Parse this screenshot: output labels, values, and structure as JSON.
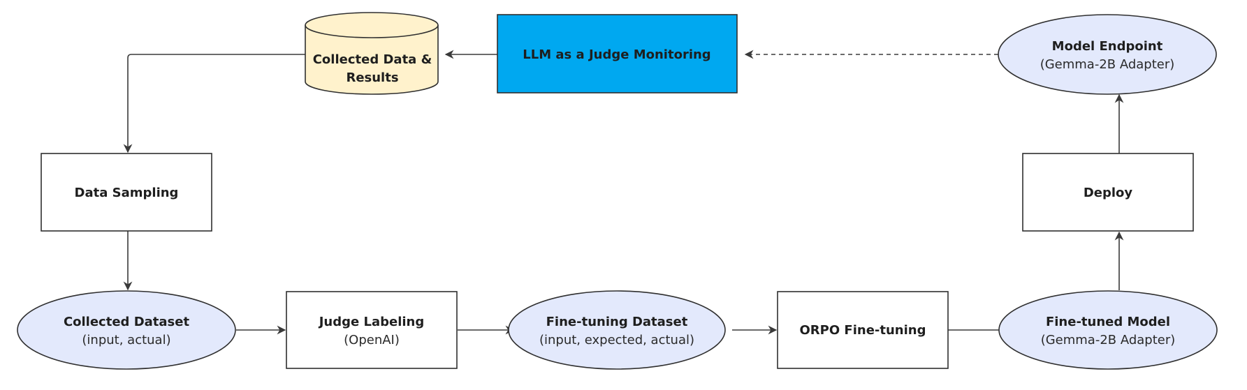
{
  "diagram": {
    "colors": {
      "stroke": "#2f2f2f",
      "ellipse_fill": "#e3e9fc",
      "box_fill": "#ffffff",
      "highlight_fill": "#00a8f0",
      "database_fill": "#fff2cc"
    },
    "nodes": {
      "collected_data_results": {
        "shape": "cylinder",
        "lines": [
          "Collected Data &",
          "Results"
        ]
      },
      "llm_judge_monitoring": {
        "shape": "rectangle",
        "title": "LLM as a Judge Monitoring"
      },
      "model_endpoint": {
        "shape": "ellipse",
        "title": "Model Endpoint",
        "subtitle": "(Gemma-2B Adapter)"
      },
      "data_sampling": {
        "shape": "rectangle",
        "title": "Data Sampling"
      },
      "deploy": {
        "shape": "rectangle",
        "title": "Deploy"
      },
      "collected_dataset": {
        "shape": "ellipse",
        "title": "Collected Dataset",
        "subtitle": "(input, actual)"
      },
      "judge_labeling": {
        "shape": "rectangle",
        "title": "Judge Labeling",
        "subtitle": "(OpenAI)"
      },
      "finetuning_dataset": {
        "shape": "ellipse",
        "title": "Fine-tuning Dataset",
        "subtitle": "(input, expected, actual)"
      },
      "orpo_finetuning": {
        "shape": "rectangle",
        "title": "ORPO Fine-tuning"
      },
      "finetuned_model": {
        "shape": "ellipse",
        "title": "Fine-tuned Model",
        "subtitle": "(Gemma-2B Adapter)"
      }
    },
    "edges": [
      {
        "from": "model_endpoint",
        "to": "llm_judge_monitoring",
        "style": "dashed"
      },
      {
        "from": "llm_judge_monitoring",
        "to": "collected_data_results",
        "style": "solid"
      },
      {
        "from": "collected_data_results",
        "to": "data_sampling",
        "style": "solid"
      },
      {
        "from": "data_sampling",
        "to": "collected_dataset",
        "style": "solid"
      },
      {
        "from": "collected_dataset",
        "to": "judge_labeling",
        "style": "solid"
      },
      {
        "from": "judge_labeling",
        "to": "finetuning_dataset",
        "style": "solid"
      },
      {
        "from": "finetuning_dataset",
        "to": "orpo_finetuning",
        "style": "solid"
      },
      {
        "from": "orpo_finetuning",
        "to": "finetuned_model",
        "style": "solid"
      },
      {
        "from": "finetuned_model",
        "to": "deploy",
        "style": "solid"
      },
      {
        "from": "deploy",
        "to": "model_endpoint",
        "style": "solid"
      }
    ]
  }
}
